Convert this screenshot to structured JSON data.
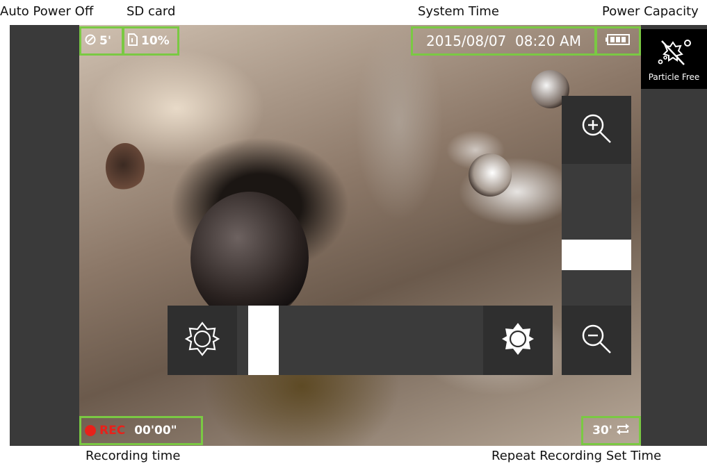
{
  "callouts": {
    "auto_power_off": "Auto Power Off",
    "sd_card": "SD card",
    "system_time": "System Time",
    "power_capacity": "Power Capacity",
    "recording_time": "Recording time",
    "repeat_recording": "Repeat Recording Set Time"
  },
  "hud": {
    "auto_off_value": "5'",
    "sd_value": "10%",
    "datetime": "2015/08/07  08:20 AM",
    "rec_label": "REC",
    "rec_time": "00'00\"",
    "repeat_value": "30'"
  },
  "side_button": {
    "label": "Particle Free",
    "icon": "particle-free-icon"
  },
  "zoom_slider": {
    "level": 0.32
  },
  "brightness_slider": {
    "level": 0.05
  },
  "colors": {
    "accent_border": "#7ac943",
    "rec": "#e8211a"
  }
}
